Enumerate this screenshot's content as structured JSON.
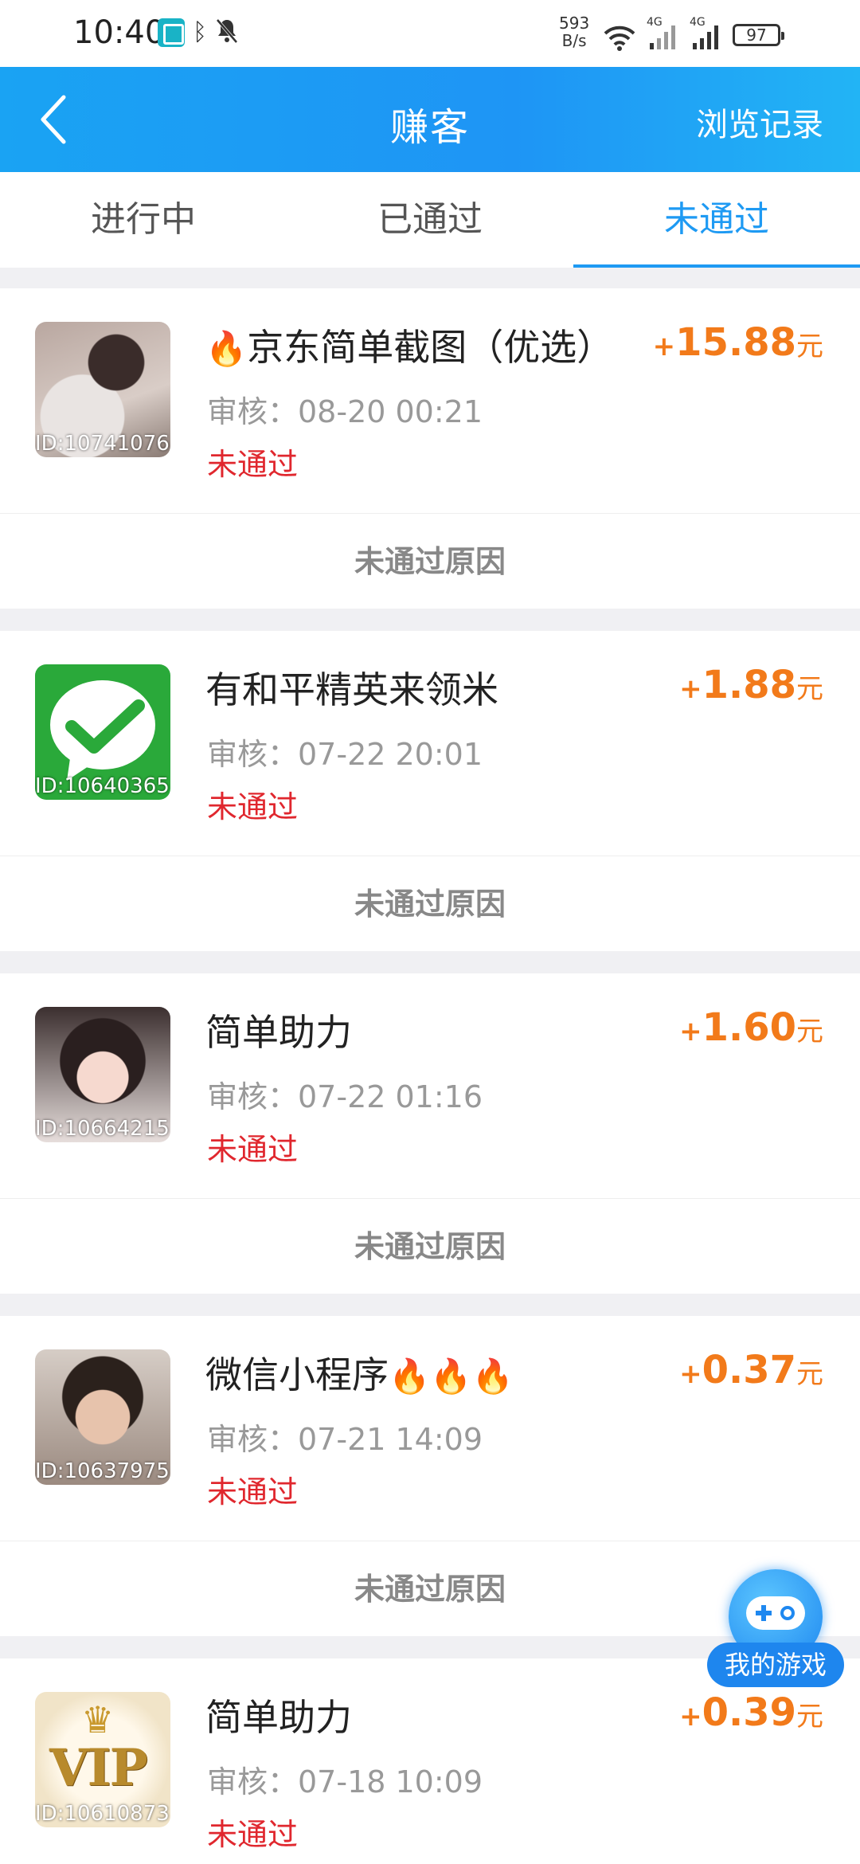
{
  "status_bar": {
    "time": "10:40",
    "net_speed_top": "593",
    "net_speed_bottom": "B/s",
    "sig1_tag": "4G",
    "sig2_tag": "4G",
    "battery": "97"
  },
  "header": {
    "title": "赚客",
    "right_label": "浏览记录"
  },
  "tabs": [
    {
      "label": "进行中",
      "active": false
    },
    {
      "label": "已通过",
      "active": false
    },
    {
      "label": "未通过",
      "active": true
    }
  ],
  "items": [
    {
      "title": "京东简单截图（优选）",
      "fire_before": true,
      "fire_after_count": 0,
      "plus": "+",
      "amount": "15.88",
      "unit": "元",
      "review": "审核：08-20 00:21",
      "status": "未通过",
      "reason": "未通过原因",
      "id_label": "ID:10741076",
      "thumb": "girl-with-cat"
    },
    {
      "title": "有和平精英来领米",
      "fire_before": false,
      "fire_after_count": 0,
      "plus": "+",
      "amount": "1.88",
      "unit": "元",
      "review": "审核：07-22 20:01",
      "status": "未通过",
      "reason": "未通过原因",
      "id_label": "ID:10640365",
      "thumb": "wechat-logo"
    },
    {
      "title": "简单助力",
      "fire_before": false,
      "fire_after_count": 0,
      "plus": "+",
      "amount": "1.60",
      "unit": "元",
      "review": "审核：07-22 01:16",
      "status": "未通过",
      "reason": "未通过原因",
      "id_label": "ID:10664215",
      "thumb": "smiling-girl"
    },
    {
      "title": "微信小程序",
      "fire_before": false,
      "fire_after_count": 3,
      "plus": "+",
      "amount": "0.37",
      "unit": "元",
      "review": "审核：07-21 14:09",
      "status": "未通过",
      "reason": "未通过原因",
      "id_label": "ID:10637975",
      "thumb": "young-man"
    },
    {
      "title": "简单助力",
      "fire_before": false,
      "fire_after_count": 0,
      "plus": "+",
      "amount": "0.39",
      "unit": "元",
      "review": "审核：07-18 10:09",
      "status": "未通过",
      "reason": "",
      "id_label": "ID:10610873",
      "thumb": "vip-badge",
      "thumb_text": "VIP"
    }
  ],
  "fab": {
    "label": "我的游戏"
  },
  "colors": {
    "accent": "#1e9af3",
    "amount": "#f27a1a",
    "rejected": "#e0272e"
  }
}
